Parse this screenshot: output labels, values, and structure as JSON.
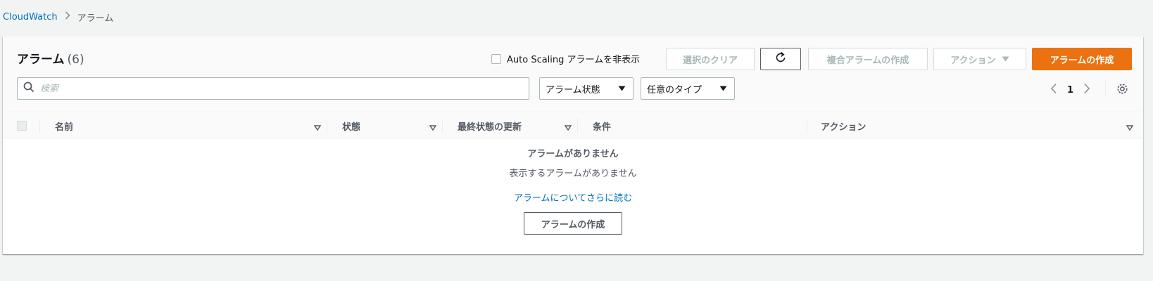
{
  "breadcrumb": {
    "root": "CloudWatch",
    "current": "アラーム"
  },
  "header": {
    "title": "アラーム",
    "count": "(6)",
    "autoscaling_toggle_label": "Auto Scaling アラームを非表示",
    "autoscaling_checked": false
  },
  "toolbar": {
    "clear_selection": "選択のクリア",
    "composite_alarm": "複合アラームの作成",
    "actions": "アクション",
    "create_alarm": "アラームの作成"
  },
  "filters": {
    "search_placeholder": "検索",
    "alarm_state": "アラーム状態",
    "any_type": "任意のタイプ"
  },
  "pagination": {
    "current_page": "1"
  },
  "table": {
    "columns": [
      "名前",
      "状態",
      "最終状態の更新",
      "条件",
      "アクション"
    ]
  },
  "empty_state": {
    "title": "アラームがありません",
    "description": "表示するアラームがありません",
    "learn_more": "アラームについてさらに読む",
    "create_button": "アラームの作成"
  },
  "colors": {
    "primary": "#ec7211",
    "link": "#0073bb",
    "text_secondary": "#545b64"
  },
  "icons": [
    "chevron-right-icon",
    "refresh-icon",
    "caret-down-icon",
    "search-icon",
    "chevron-left-icon",
    "gear-icon",
    "sort-icon"
  ]
}
